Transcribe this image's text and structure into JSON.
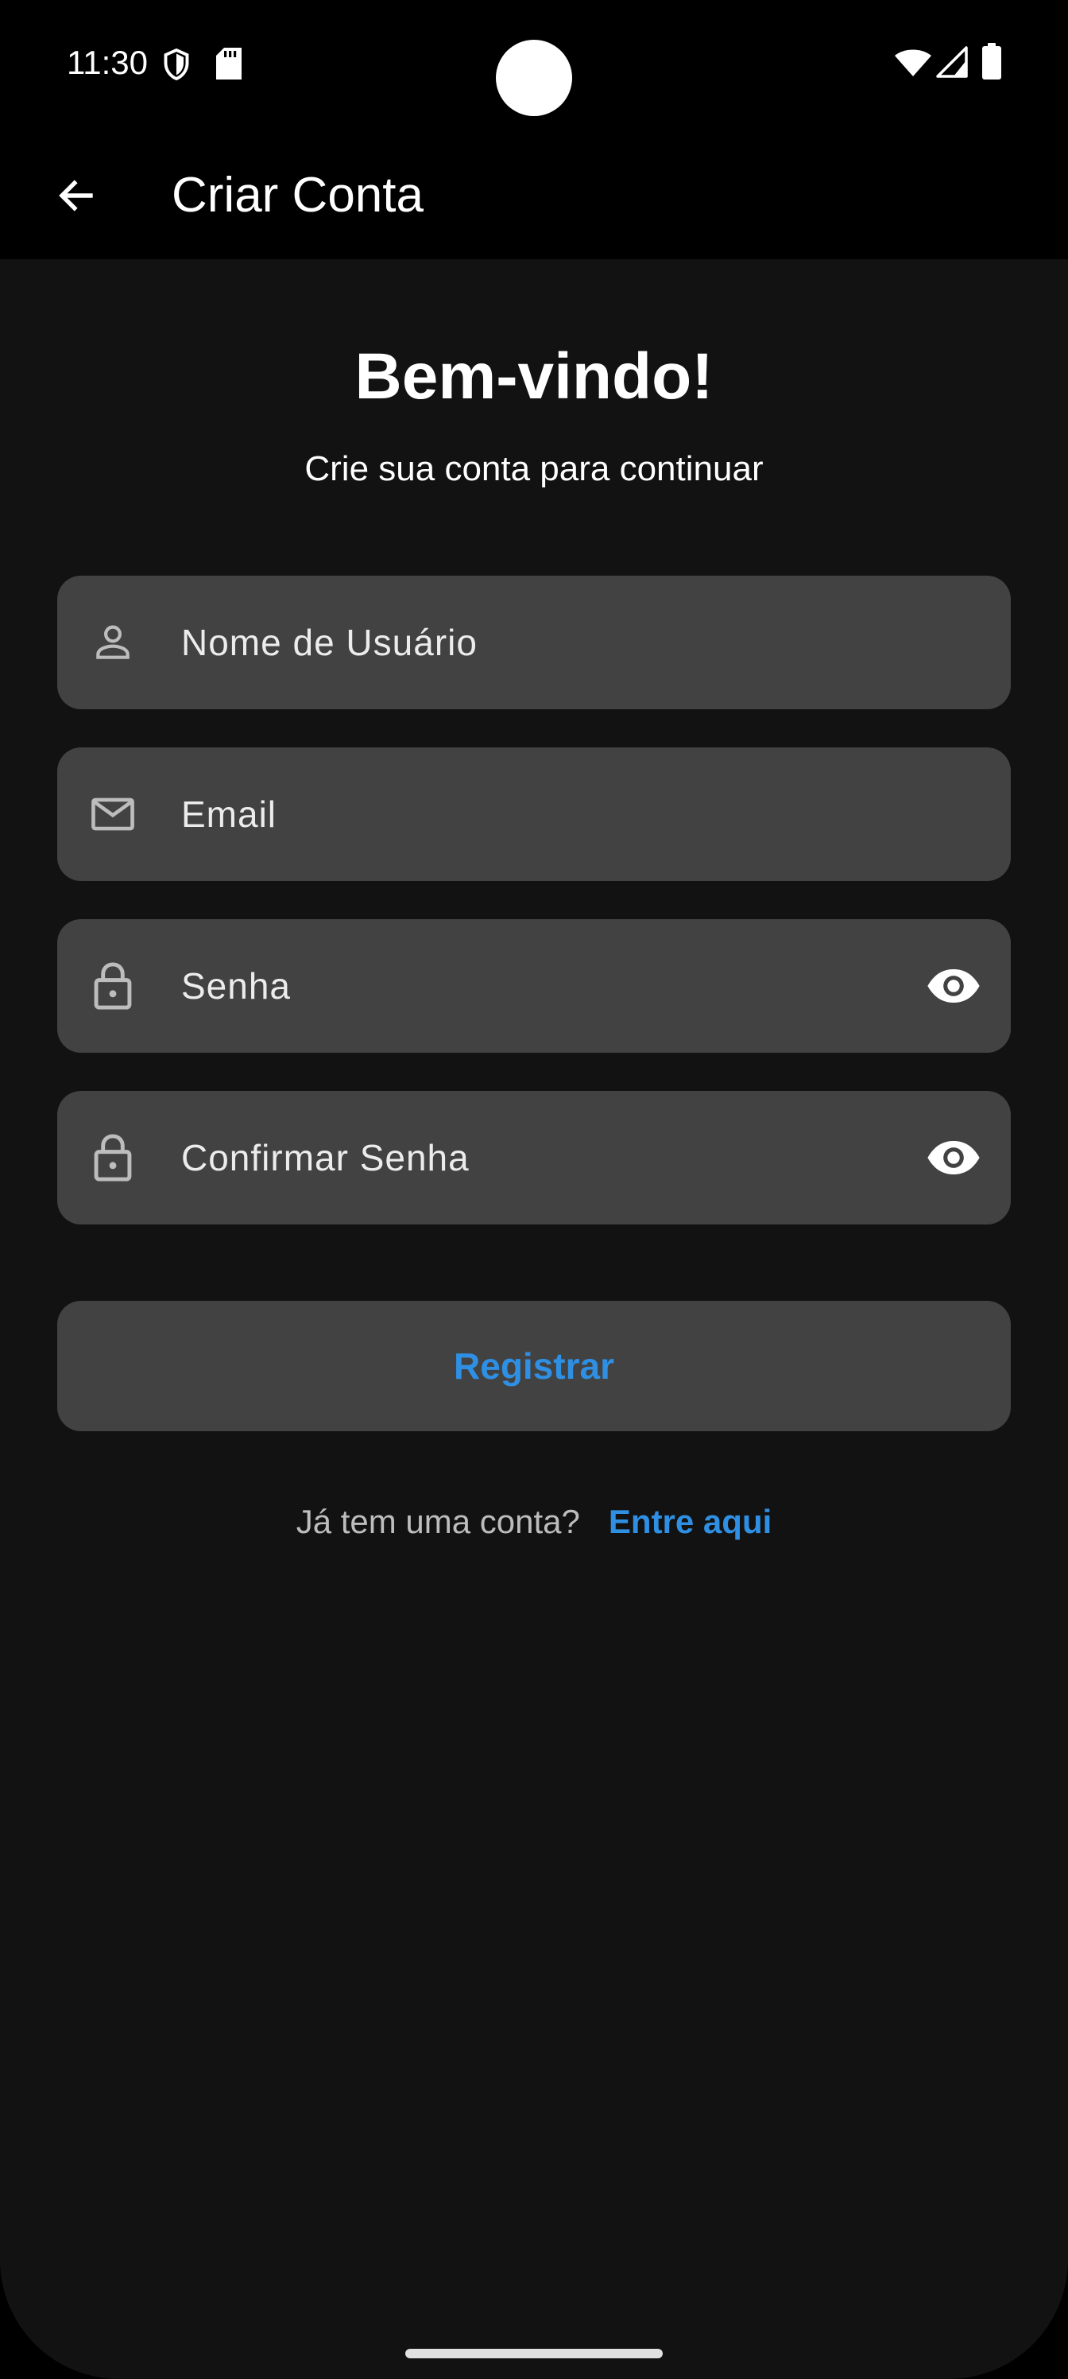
{
  "status_bar": {
    "time": "11:30"
  },
  "app_bar": {
    "title": "Criar Conta"
  },
  "header": {
    "welcome": "Bem-vindo!",
    "subtitle": "Crie sua conta para continuar"
  },
  "form": {
    "username_label": "Nome de Usuário",
    "email_label": "Email",
    "password_label": "Senha",
    "confirm_password_label": "Confirmar Senha",
    "register_label": "Registrar"
  },
  "footer": {
    "question": "Já tem uma conta?",
    "link": "Entre aqui"
  },
  "colors": {
    "background": "#121212",
    "field": "#424242",
    "accent": "#2f8fe3"
  }
}
